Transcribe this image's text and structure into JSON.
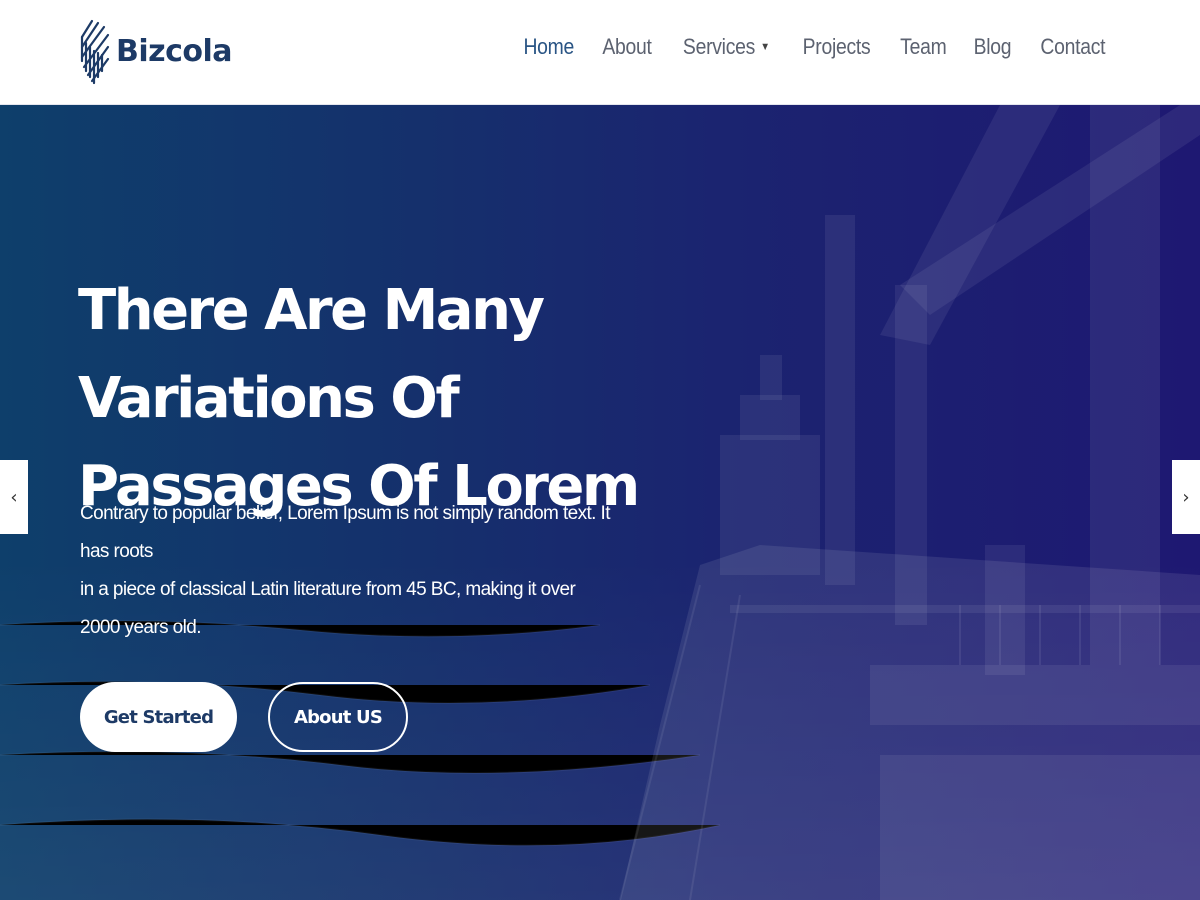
{
  "brand": {
    "name": "Bizcola",
    "logo_icon": "striped-diamond-icon",
    "color": "#1d3a66"
  },
  "nav": {
    "items": [
      {
        "label": "Home",
        "active": true
      },
      {
        "label": "About"
      },
      {
        "label": "Services",
        "has_dropdown": true
      },
      {
        "label": "Projects"
      },
      {
        "label": "Team"
      },
      {
        "label": "Blog"
      },
      {
        "label": "Contact"
      }
    ],
    "dropdown_icon": "caret-down-icon"
  },
  "hero": {
    "title_line1": "There Are Many Variations Of",
    "title_line2": "Passages Of Lorem",
    "desc_line1": "Contrary to popular belief, Lorem Ipsum is not simply random text. It has roots",
    "desc_line2": "in a piece of classical Latin literature from 45 BC, making it over",
    "desc_line3": "2000 years old.",
    "primary_button": "Get Started",
    "secondary_button": "About US",
    "background_image": "cargo-ship-deck-at-sea",
    "overlay_colors": [
      "#0e3f6b",
      "#1e1872"
    ]
  },
  "slider": {
    "prev_icon": "chevron-left-icon",
    "next_icon": "chevron-right-icon",
    "prev_glyph": "‹",
    "next_glyph": "›"
  }
}
